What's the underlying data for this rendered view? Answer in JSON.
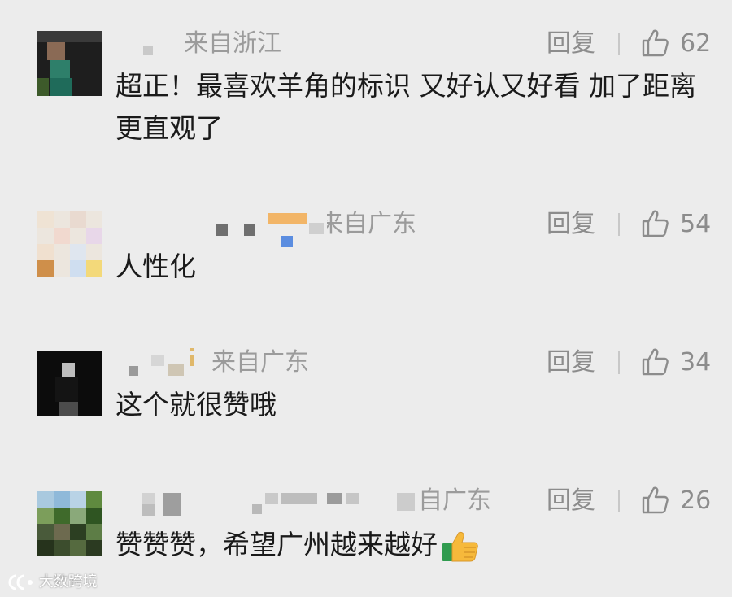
{
  "comments": [
    {
      "location": "来自浙江",
      "reply": "回复",
      "likes": "62",
      "text": "超正！最喜欢羊角的标识 又好认又好看 加了距离更直观了"
    },
    {
      "location": "来自广东",
      "reply": "回复",
      "likes": "54",
      "text": "人性化"
    },
    {
      "location": "来自广东",
      "reply": "回复",
      "likes": "34",
      "text": "这个就很赞哦"
    },
    {
      "location": "自广东",
      "reply": "回复",
      "likes": "26",
      "text": "赞赞赞，希望广州越来越好",
      "emoji": "thumbs-up-emoji"
    }
  ],
  "watermark": {
    "text": "大数跨境"
  },
  "colors": {
    "background": "#ececec",
    "meta_text": "#8c8c8c",
    "body_text": "#1a1a1a"
  }
}
